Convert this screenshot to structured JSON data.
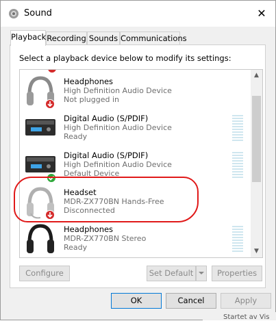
{
  "window": {
    "title": "Sound",
    "close_glyph": "✕"
  },
  "tabs": [
    {
      "label": "Playback"
    },
    {
      "label": "Recording"
    },
    {
      "label": "Sounds"
    },
    {
      "label": "Communications"
    }
  ],
  "instruction": "Select a playback device below to modify its settings:",
  "devices": [
    {
      "name": "Headphones",
      "desc": "High Definition Audio Device",
      "status": "Not plugged in",
      "icon": "headphones-icon",
      "badge": "red-down-arrow"
    },
    {
      "name": "Digital Audio (S/PDIF)",
      "desc": "High Definition Audio Device",
      "status": "Ready",
      "icon": "spdif-device-icon",
      "badge": "none"
    },
    {
      "name": "Digital Audio (S/PDIF)",
      "desc": "High Definition Audio Device",
      "status": "Default Device",
      "icon": "spdif-device-icon",
      "badge": "green-check"
    },
    {
      "name": "Headset",
      "desc": "MDR-ZX770BN Hands-Free",
      "status": "Disconnected",
      "icon": "headset-icon",
      "badge": "red-down-arrow"
    },
    {
      "name": "Headphones",
      "desc": "MDR-ZX770BN Stereo",
      "status": "Ready",
      "icon": "headphones-icon",
      "badge": "none"
    }
  ],
  "buttons": {
    "configure": "Configure",
    "set_default": "Set Default",
    "properties": "Properties",
    "ok": "OK",
    "cancel": "Cancel",
    "apply": "Apply"
  },
  "background_text": "Startet av Vis",
  "colors": {
    "annotation": "#e01818",
    "ok_border": "#0078d7"
  }
}
